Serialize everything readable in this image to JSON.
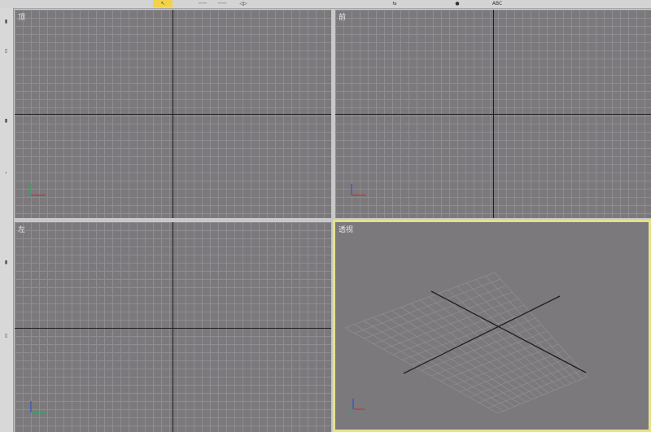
{
  "toolbar": {
    "buttons": [
      {
        "id": "select",
        "label": "↖",
        "active": true
      },
      {
        "id": "snap-grid",
        "label": "┄┄┄",
        "active": false
      },
      {
        "id": "snap-angle",
        "label": "┄┄┄",
        "active": false
      },
      {
        "id": "mirror",
        "label": "◁▷",
        "active": false
      },
      {
        "id": "align",
        "label": "⇆",
        "active": false
      },
      {
        "id": "render",
        "label": "●",
        "active": false
      },
      {
        "id": "text",
        "label": "ABC",
        "active": false
      }
    ]
  },
  "viewports": {
    "top": {
      "label": "顶"
    },
    "front": {
      "label": "前"
    },
    "left": {
      "label": "左"
    },
    "perspective": {
      "label": "透视",
      "active": true
    }
  },
  "colors": {
    "viewport_bg": "#7b797c",
    "grid_line": "#8f8d91",
    "active_border": "#e6e28a",
    "axis_x": "#c0392b",
    "axis_y": "#27ae60",
    "axis_z": "#2e4fd0"
  }
}
